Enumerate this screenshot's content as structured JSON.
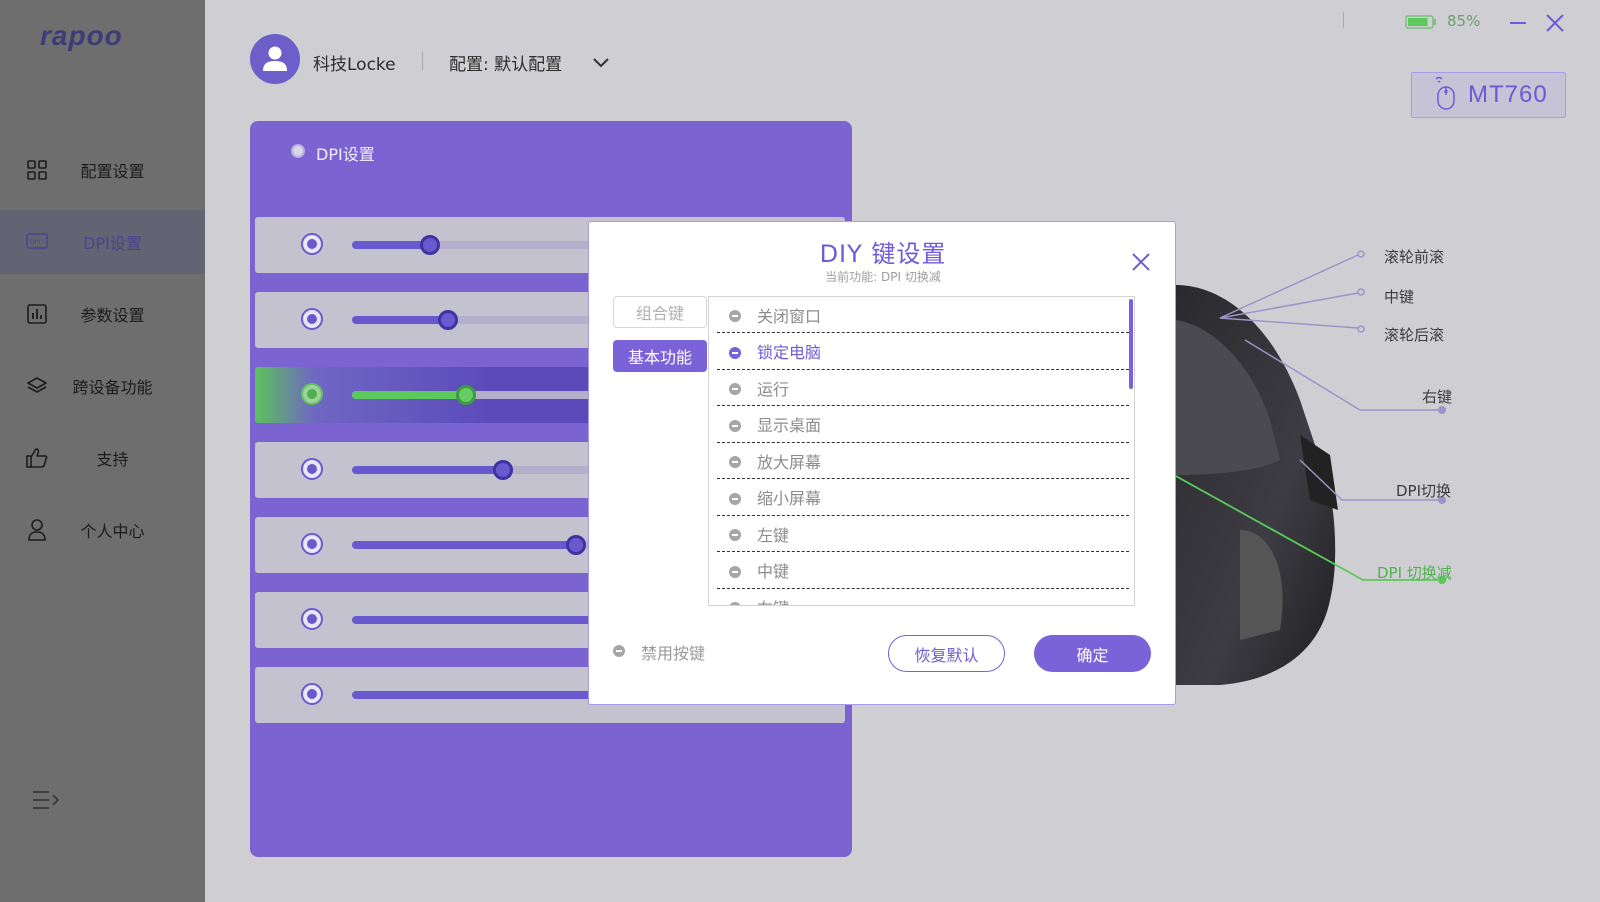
{
  "brand": {
    "logo_text": "rapoo"
  },
  "sidebar": {
    "items": [
      {
        "label": "配置设置",
        "icon": "grid-icon"
      },
      {
        "label": "DPI设置",
        "icon": "dpi-icon",
        "active": true
      },
      {
        "label": "参数设置",
        "icon": "chart-icon"
      },
      {
        "label": "跨设备功能",
        "icon": "layers-icon"
      },
      {
        "label": "支持",
        "icon": "thumbs-up-icon"
      },
      {
        "label": "个人中心",
        "icon": "user-icon"
      }
    ],
    "collapse_icon": "menu-collapse-icon"
  },
  "header": {
    "username": "科技Locke",
    "config_label": "配置: 默认配置"
  },
  "status": {
    "battery_percent": "85%",
    "battery_level": 0.85,
    "device_name": "MT760"
  },
  "dpi_panel": {
    "title": "DPI设置",
    "rows": [
      {
        "level": 0.3,
        "active": false
      },
      {
        "level": 0.37,
        "active": false
      },
      {
        "level": 0.44,
        "active": true
      },
      {
        "level": 0.58,
        "active": false
      },
      {
        "level": 0.86,
        "active": false
      },
      {
        "level": 1.0,
        "active": false
      },
      {
        "level": 1.0,
        "active": false
      }
    ]
  },
  "mouse_callouts": {
    "scroll_up": "滚轮前滚",
    "middle": "中键",
    "scroll_down": "滚轮后滚",
    "right": "右键",
    "dpi_switch": "DPI切换",
    "dpi_down": "DPI 切换减"
  },
  "dialog": {
    "title": "DIY 键设置",
    "subtitle": "当前功能: DPI 切换减",
    "tabs": {
      "combo": "组合键",
      "basic": "基本功能"
    },
    "list": [
      {
        "label": "关闭窗口",
        "selected": false
      },
      {
        "label": "锁定电脑",
        "selected": true
      },
      {
        "label": "运行",
        "selected": false
      },
      {
        "label": "显示桌面",
        "selected": false
      },
      {
        "label": "放大屏幕",
        "selected": false
      },
      {
        "label": "缩小屏幕",
        "selected": false
      },
      {
        "label": "左键",
        "selected": false
      },
      {
        "label": "中键",
        "selected": false
      },
      {
        "label": "右键",
        "selected": false
      }
    ],
    "disable_label": "禁用按键",
    "reset_label": "恢复默认",
    "ok_label": "确定"
  },
  "colors": {
    "accent": "#7a62d9",
    "panel": "#7b63d1",
    "active_green": "#5cc95c"
  }
}
